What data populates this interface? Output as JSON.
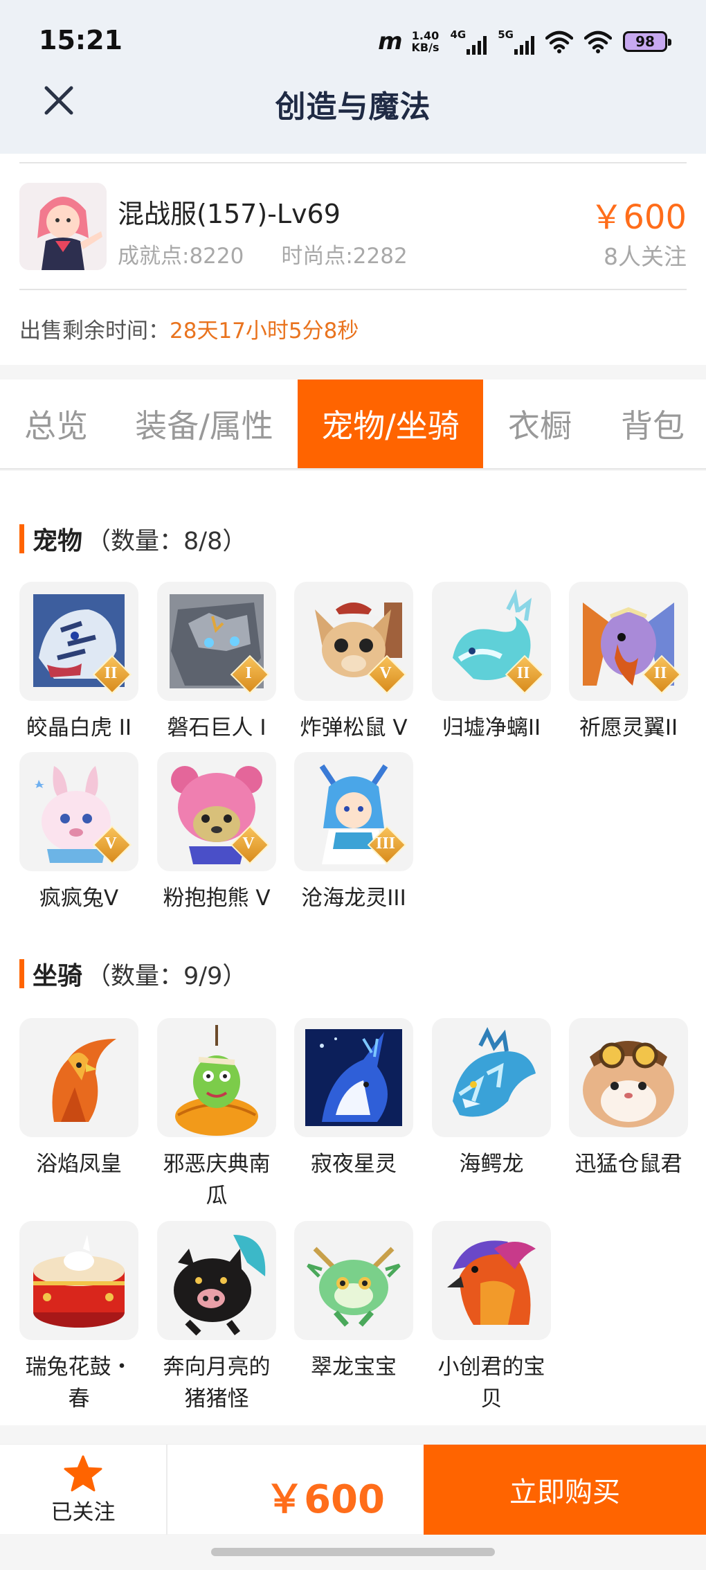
{
  "status_bar": {
    "time": "15:21",
    "speed_value": "1.40",
    "speed_unit": "KB/s",
    "net1": "4G",
    "net2": "5G",
    "battery": "98"
  },
  "header": {
    "title": "创造与魔法",
    "close_icon": "close-icon"
  },
  "product": {
    "name": "混战服(157)-Lv69",
    "achievement": "成就点:8220",
    "fashion": "时尚点:2282",
    "price": "￥600",
    "followers": "8人关注",
    "remain_label": "出售剩余时间：",
    "remain_value": "28天17小时5分8秒"
  },
  "tabs": [
    {
      "label": "总览",
      "active": false
    },
    {
      "label": "装备/属性",
      "active": false
    },
    {
      "label": "宠物/坐骑",
      "active": true
    },
    {
      "label": "衣橱",
      "active": false
    },
    {
      "label": "背包",
      "active": false
    }
  ],
  "pets": {
    "title": "宠物",
    "count": "（数量：8/8）",
    "items": [
      {
        "name": "皎晶白虎 II",
        "tier": "II"
      },
      {
        "name": "磐石巨人 I",
        "tier": "I"
      },
      {
        "name": "炸弹松鼠 V",
        "tier": "V"
      },
      {
        "name": "归墟净螭II",
        "tier": "II"
      },
      {
        "name": "祈愿灵翼II",
        "tier": "II"
      },
      {
        "name": "疯疯兔V",
        "tier": "V"
      },
      {
        "name": "粉抱抱熊 V",
        "tier": "V"
      },
      {
        "name": "沧海龙灵III",
        "tier": "III"
      }
    ]
  },
  "mounts": {
    "title": "坐骑",
    "count": "（数量：9/9）",
    "items": [
      {
        "name": "浴焰凤皇"
      },
      {
        "name": "邪恶庆典南瓜"
      },
      {
        "name": "寂夜星灵"
      },
      {
        "name": "海鳄龙"
      },
      {
        "name": "迅猛仓鼠君"
      },
      {
        "name": "瑞兔花鼓・春"
      },
      {
        "name": "奔向月亮的猪猪怪"
      },
      {
        "name": "翠龙宝宝"
      },
      {
        "name": "小创君的宝贝"
      }
    ]
  },
  "bottom": {
    "follow_label": "已关注",
    "price": "￥600",
    "buy_label": "立即购买"
  },
  "colors": {
    "accent": "#ff6400",
    "price": "#ff6d1a",
    "header_bg": "#edf1f6"
  }
}
